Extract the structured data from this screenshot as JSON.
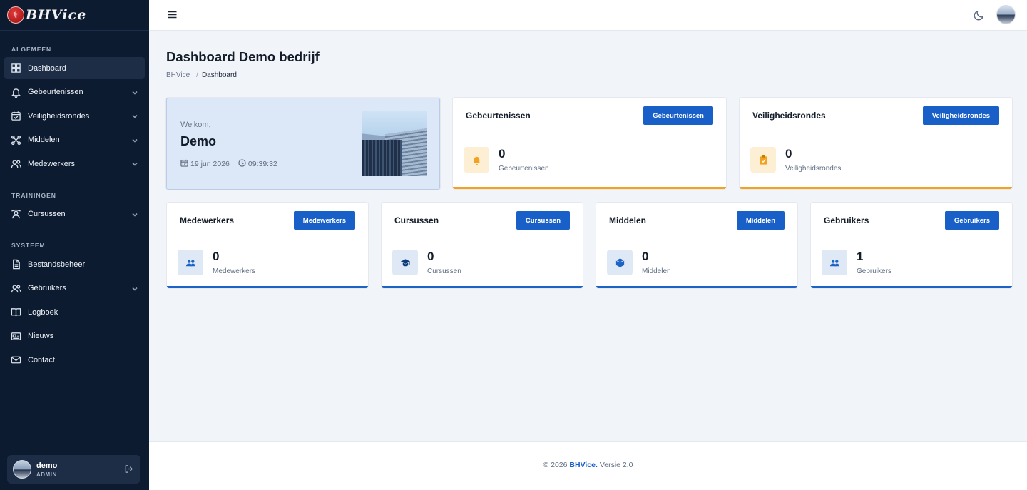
{
  "app": {
    "logo_text": "BHVice",
    "logo_glyph": "⚕"
  },
  "sidebar": {
    "sections": [
      {
        "title": "ALGEMEEN",
        "items": [
          {
            "label": "Dashboard",
            "icon": "grid-icon",
            "active": true,
            "has_children": false
          },
          {
            "label": "Gebeurtenissen",
            "icon": "bell-icon",
            "has_children": true
          },
          {
            "label": "Veiligheidsrondes",
            "icon": "calendar-check-icon",
            "has_children": true
          },
          {
            "label": "Middelen",
            "icon": "tools-icon",
            "has_children": true
          },
          {
            "label": "Medewerkers",
            "icon": "users-icon",
            "has_children": true
          }
        ]
      },
      {
        "title": "TRAININGEN",
        "items": [
          {
            "label": "Cursussen",
            "icon": "training-icon",
            "has_children": true
          }
        ]
      },
      {
        "title": "SYSTEEM",
        "items": [
          {
            "label": "Bestandsbeheer",
            "icon": "file-icon",
            "has_children": false
          },
          {
            "label": "Gebruikers",
            "icon": "users-icon",
            "has_children": true
          },
          {
            "label": "Logboek",
            "icon": "book-icon",
            "has_children": false
          },
          {
            "label": "Nieuws",
            "icon": "news-icon",
            "has_children": false
          },
          {
            "label": "Contact",
            "icon": "mail-icon",
            "has_children": false
          }
        ]
      }
    ],
    "user": {
      "name": "demo",
      "role": "ADMIN"
    }
  },
  "page": {
    "title": "Dashboard Demo bedrijf",
    "breadcrumb": {
      "root": "BHVice",
      "separator": "/",
      "current": "Dashboard"
    }
  },
  "welcome": {
    "greeting": "Welkom,",
    "name": "Demo",
    "date": "19 jun 2026",
    "time": "09:39:32"
  },
  "stats_top": [
    {
      "title": "Gebeurtenissen",
      "button": "Gebeurtenissen",
      "value": "0",
      "label": "Gebeurtenissen",
      "icon": "bell-icon"
    },
    {
      "title": "Veiligheidsrondes",
      "button": "Veiligheidsrondes",
      "value": "0",
      "label": "Veiligheidsrondes",
      "icon": "clipboard-icon"
    }
  ],
  "stats_bottom": [
    {
      "title": "Medewerkers",
      "button": "Medewerkers",
      "value": "0",
      "label": "Medewerkers",
      "icon": "users-icon"
    },
    {
      "title": "Cursussen",
      "button": "Cursussen",
      "value": "0",
      "label": "Cursussen",
      "icon": "graduation-cap-icon"
    },
    {
      "title": "Middelen",
      "button": "Middelen",
      "value": "0",
      "label": "Middelen",
      "icon": "box-icon"
    },
    {
      "title": "Gebruikers",
      "button": "Gebruikers",
      "value": "1",
      "label": "Gebruikers",
      "icon": "users-icon"
    }
  ],
  "footer": {
    "prefix": "© 2026 ",
    "brand": "BHVice.",
    "suffix": " Versie 2.0"
  },
  "colors": {
    "sidebar_bg": "#0d1b30",
    "primary": "#1860c8",
    "orange": "#f2a21e",
    "blue_accent": "#1b63c4"
  }
}
